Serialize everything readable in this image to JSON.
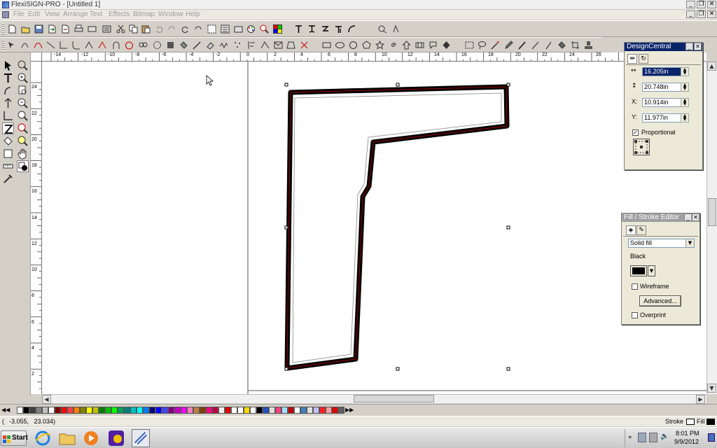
{
  "window": {
    "title": "FlexiSIGN-PRO - [Untitled 1]",
    "controls": [
      "_",
      "❐",
      "✕"
    ],
    "mdi_controls": [
      "_",
      "❐",
      "✕"
    ]
  },
  "menu": [
    "File",
    "Edit",
    "View",
    "Arrange",
    "Text",
    "Effects",
    "Bitmap",
    "Window",
    "Help"
  ],
  "ruler": {
    "unit": "inches",
    "h_labels": [
      "-14",
      "-12",
      "-10",
      "-8",
      "-6",
      "-4",
      "-2",
      "0",
      "2",
      "4",
      "6",
      "8",
      "10",
      "12",
      "14",
      "16",
      "18",
      "20",
      "22",
      "24",
      "26"
    ],
    "v_labels": [
      "24",
      "22",
      "20",
      "18",
      "16",
      "14",
      "12",
      "10",
      "8",
      "6",
      "4",
      "2"
    ]
  },
  "design_central": {
    "title": "DesignCentral",
    "width": "16.205in",
    "height": "20.748in",
    "x": "10.914in",
    "y": "11.977in",
    "labels": {
      "x": "X:",
      "y": "Y:"
    },
    "proportional_label": "Proportional",
    "proportional_checked": "✓"
  },
  "fill_stroke": {
    "title": "Fill / Stroke Editor",
    "fill_type": "Solid fill",
    "color_name": "Black",
    "color_hex": "#000000",
    "wireframe_label": "Wireframe",
    "advanced_label": "Advanced...",
    "overprint_label": "Overprint"
  },
  "status": {
    "coordinates": "-3.055,   23.034)",
    "coords_open": "(",
    "stroke_label": "Stroke",
    "fill_label": "Fill"
  },
  "taskbar": {
    "start_label": "Start",
    "time": "8:01 PM",
    "date": "9/9/2012"
  },
  "colors": {
    "shape_outline": "#000000",
    "shape_highlight": "#a00000",
    "title_active": "#0a246a",
    "title_inactive": "#a0a0a0"
  }
}
